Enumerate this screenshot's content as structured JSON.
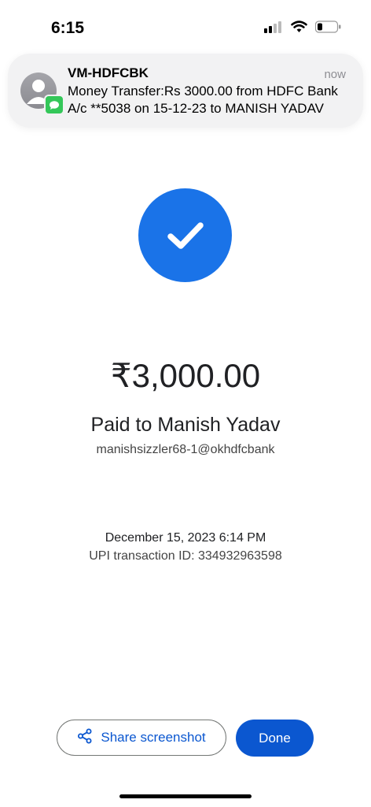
{
  "status_bar": {
    "time": "6:15"
  },
  "notification": {
    "sender": "VM-HDFCBK",
    "time": "now",
    "body": "Money Transfer:Rs 3000.00 from HDFC Bank A/c **5038 on 15-12-23 to MANISH YADAV"
  },
  "payment": {
    "amount": "₹3,000.00",
    "paid_to": "Paid to Manish Yadav",
    "upi_id": "manishsizzler68-1@okhdfcbank",
    "date": "December 15, 2023 6:14 PM",
    "transaction_id": "UPI transaction ID: 334932963598"
  },
  "actions": {
    "share_label": "Share screenshot",
    "done_label": "Done"
  },
  "colors": {
    "accent": "#1a73e8",
    "button": "#0b57d0",
    "message_badge": "#34c759"
  }
}
